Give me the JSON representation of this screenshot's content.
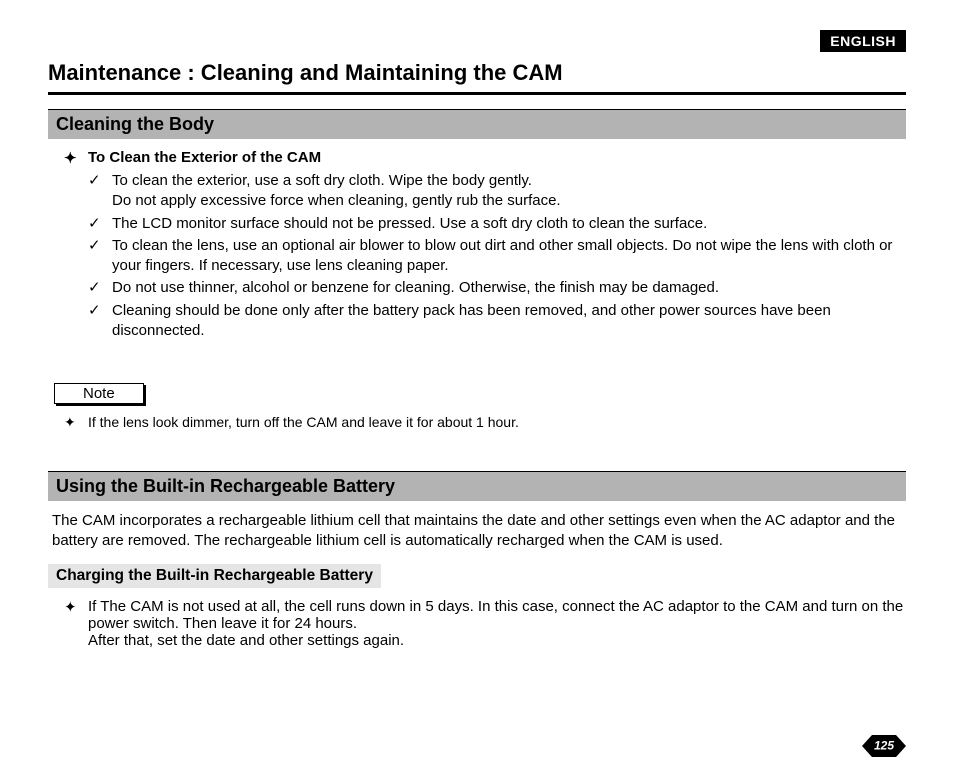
{
  "language_tag": "ENGLISH",
  "main_title": "Maintenance : Cleaning and Maintaining the CAM",
  "section1": {
    "heading": "Cleaning the Body",
    "intro_bullet": "To Clean the Exterior of the CAM",
    "checks": [
      "To clean the exterior, use a soft dry cloth. Wipe the body gently.\nDo not apply excessive force when cleaning, gently rub the surface.",
      "The LCD monitor surface should not be pressed. Use a soft dry cloth to clean the surface.",
      "To clean the lens, use an optional air blower to blow out dirt and other small objects. Do not wipe the lens with cloth or your fingers. If necessary, use lens cleaning paper.",
      "Do not use thinner, alcohol or benzene for cleaning. Otherwise, the finish may be damaged.",
      "Cleaning should be done only after the battery pack has been removed, and other power sources have been disconnected."
    ]
  },
  "note_label": "Note",
  "note_text": "If the lens look dimmer, turn off the CAM and leave it for about 1 hour.",
  "section2": {
    "heading": "Using the Built-in Rechargeable Battery",
    "paragraph": "The CAM incorporates a rechargeable lithium cell that maintains the date and other settings even when the AC adaptor and the battery are removed. The rechargeable lithium cell is automatically recharged when the CAM is used.",
    "subheading": "Charging the Built-in Rechargeable Battery",
    "sub_bullet": "If The CAM is not used at all, the cell runs down in 5 days. In this case, connect the AC adaptor to the CAM and turn on the power switch. Then leave it for 24 hours.\nAfter that, set the date and other settings again."
  },
  "page_number": "125"
}
